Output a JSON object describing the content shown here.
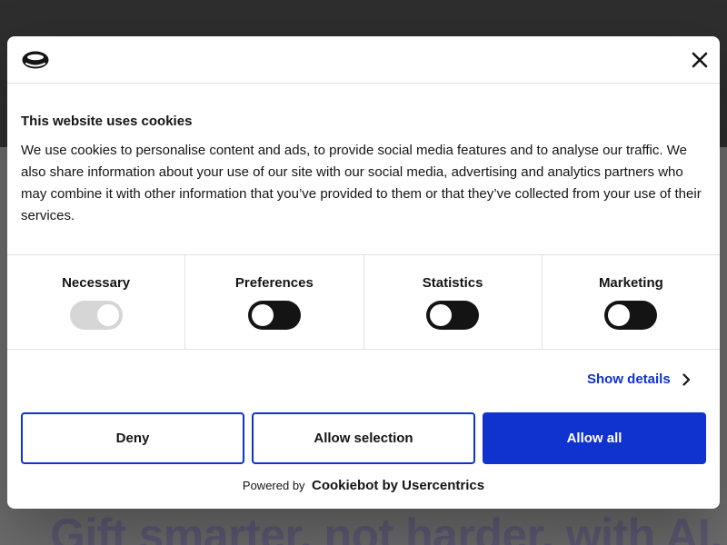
{
  "background": {
    "headline": "Gift smarter, not harder, with AI."
  },
  "dialog": {
    "logo_icon": "cookiebot-logo-icon",
    "close_icon": "close-icon",
    "title": "This website uses cookies",
    "body": "We use cookies to personalise content and ads, to provide social media features and to analyse our traffic. We also share information about your use of our site with our social media, advertising and analytics partners who may combine it with other information that you’ve provided to them or that they’ve collected from your use of their services.",
    "categories": [
      {
        "label": "Necessary",
        "checked": true,
        "disabled": true
      },
      {
        "label": "Preferences",
        "checked": false,
        "disabled": false
      },
      {
        "label": "Statistics",
        "checked": false,
        "disabled": false
      },
      {
        "label": "Marketing",
        "checked": false,
        "disabled": false
      }
    ],
    "show_details": "Show details",
    "buttons": {
      "deny": "Deny",
      "allow_selection": "Allow selection",
      "allow_all": "Allow all"
    },
    "powered_by": "Powered by",
    "brand": "Cookiebot by Usercentrics",
    "colors": {
      "accent": "#1032cf",
      "text": "#141414",
      "toggle_off": "#141414",
      "toggle_disabled": "#d6d6d6"
    }
  }
}
